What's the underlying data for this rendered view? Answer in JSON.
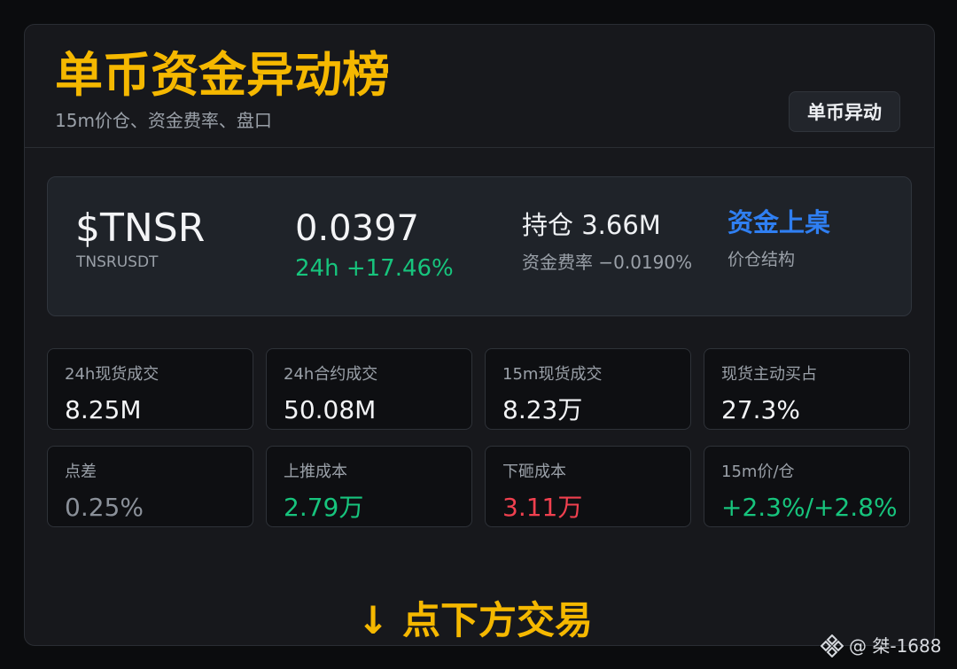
{
  "header": {
    "title": "单币资金异动榜",
    "subtitle": "15m价仓、资金费率、盘口",
    "tag": "单币异动"
  },
  "summary": {
    "ticker": "$TNSR",
    "pair": "TNSRUSDT",
    "price": "0.0397",
    "change_24h": "24h +17.46%",
    "open_interest": "持仓 3.66M",
    "funding_rate": "资金费率 −0.0190%",
    "flow_link": "资金上桌",
    "structure": "价仓结构"
  },
  "metrics": [
    {
      "label": "24h现货成交",
      "value": "8.25M",
      "color": "#f3f4f6"
    },
    {
      "label": "24h合约成交",
      "value": "50.08M",
      "color": "#f3f4f6"
    },
    {
      "label": "15m现货成交",
      "value": "8.23万",
      "color": "#f3f4f6"
    },
    {
      "label": "现货主动买占",
      "value": "27.3%",
      "color": "#f3f4f6"
    },
    {
      "label": "点差",
      "value": "0.25%",
      "color": "#8a9099"
    },
    {
      "label": "上推成本",
      "value": "2.79万",
      "color": "#17c47d"
    },
    {
      "label": "下砸成本",
      "value": "3.11万",
      "color": "#f0404f"
    },
    {
      "label": "15m价/仓",
      "value": "+2.3%/+2.8%",
      "color": "#17c47d"
    }
  ],
  "cta": "↓ 点下方交易",
  "watermark": {
    "icon": "binance-square-icon",
    "handle": "@ 桀-1688"
  },
  "colors": {
    "accent": "#f5b800",
    "up": "#17c47d",
    "down": "#f0404f",
    "link": "#2f7ff2"
  }
}
